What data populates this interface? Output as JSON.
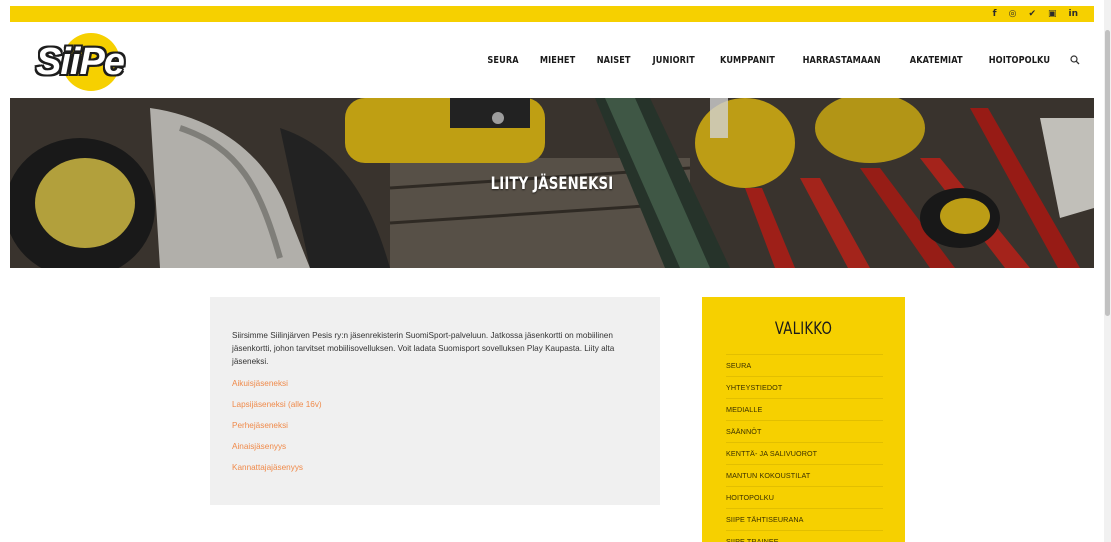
{
  "colors": {
    "brand_yellow": "#f6d000",
    "link_orange": "#ef8a4a",
    "panel_gray": "#f0f0f0"
  },
  "social": [
    {
      "icon": "facebook-icon",
      "glyph": "f"
    },
    {
      "icon": "instagram-icon",
      "glyph": "◎"
    },
    {
      "icon": "twitter-icon",
      "glyph": "✔"
    },
    {
      "icon": "youtube-icon",
      "glyph": "▣"
    },
    {
      "icon": "linkedin-icon",
      "glyph": "in"
    }
  ],
  "logo": {
    "text": "SiiPe"
  },
  "nav": {
    "items": [
      "SEURA",
      "MIEHET",
      "NAISET",
      "JUNIORIT",
      "KUMPPANIT",
      "HARRASTAMAAN",
      "AKATEMIAT",
      "HOITOPOLKU"
    ],
    "search_icon": "search-icon"
  },
  "hero": {
    "title": "LIITY JÄSENEKSI"
  },
  "content": {
    "intro": "Siirsimme Siilinjärven Pesis ry:n jäsenrekisterin SuomiSport-palveluun. Jatkossa jäsenkortti on mobiilinen jäsenkortti, johon tarvitset mobiilisovelluksen. Voit ladata Suomisport sovelluksen Play Kaupasta. Liity alta jäseneksi.",
    "links": [
      "Aikuisjäseneksi",
      "Lapsijäseneksi (alle 16v)",
      "Perhejäseneksi",
      "Ainaisjäsenyys",
      "Kannattajajäsenyys"
    ]
  },
  "sidebar": {
    "title": "VALIKKO",
    "items": [
      "SEURA",
      "YHTEYSTIEDOT",
      "MEDIALLE",
      "SÄÄNNÖT",
      "KENTTÄ- JA SALIVUOROT",
      "MANTUN KOKOUSTILAT",
      "HOITOPOLKU",
      "SIIPE TÄHTISEURANA",
      "SIIPE TRAINEE"
    ]
  }
}
